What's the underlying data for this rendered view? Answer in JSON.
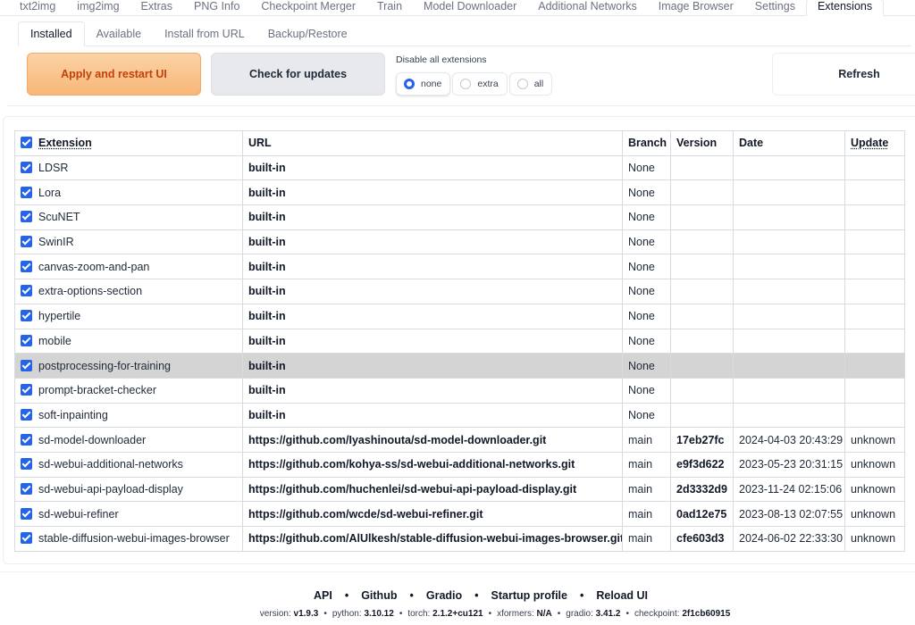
{
  "top_tabs": [
    "txt2img",
    "img2img",
    "Extras",
    "PNG Info",
    "Checkpoint Merger",
    "Train",
    "Model Downloader",
    "Additional Networks",
    "Image Browser",
    "Settings",
    "Extensions"
  ],
  "sub_tabs": [
    "Installed",
    "Available",
    "Install from URL",
    "Backup/Restore"
  ],
  "actions": {
    "apply_label": "Apply and restart UI",
    "check_label": "Check for updates",
    "refresh_label": "Refresh"
  },
  "disable": {
    "label": "Disable all extensions",
    "options": [
      "none",
      "extra",
      "all"
    ],
    "selected": "none"
  },
  "colors": {
    "accent": "#2563eb",
    "apply_bg": "#f8b677",
    "apply_text": "#c2410c",
    "highlight_row": "#d4d4d4"
  },
  "table": {
    "headers": [
      "Extension",
      "URL",
      "Branch",
      "Version",
      "Date",
      "Update"
    ],
    "rows": [
      {
        "name": "LDSR",
        "url": "built-in",
        "branch": "None",
        "version": "",
        "date": "",
        "update": ""
      },
      {
        "name": "Lora",
        "url": "built-in",
        "branch": "None",
        "version": "",
        "date": "",
        "update": ""
      },
      {
        "name": "ScuNET",
        "url": "built-in",
        "branch": "None",
        "version": "",
        "date": "",
        "update": ""
      },
      {
        "name": "SwinIR",
        "url": "built-in",
        "branch": "None",
        "version": "",
        "date": "",
        "update": ""
      },
      {
        "name": "canvas-zoom-and-pan",
        "url": "built-in",
        "branch": "None",
        "version": "",
        "date": "",
        "update": ""
      },
      {
        "name": "extra-options-section",
        "url": "built-in",
        "branch": "None",
        "version": "",
        "date": "",
        "update": ""
      },
      {
        "name": "hypertile",
        "url": "built-in",
        "branch": "None",
        "version": "",
        "date": "",
        "update": ""
      },
      {
        "name": "mobile",
        "url": "built-in",
        "branch": "None",
        "version": "",
        "date": "",
        "update": ""
      },
      {
        "name": "postprocessing-for-training",
        "url": "built-in",
        "branch": "None",
        "version": "",
        "date": "",
        "update": "",
        "highlighted": true
      },
      {
        "name": "prompt-bracket-checker",
        "url": "built-in",
        "branch": "None",
        "version": "",
        "date": "",
        "update": ""
      },
      {
        "name": "soft-inpainting",
        "url": "built-in",
        "branch": "None",
        "version": "",
        "date": "",
        "update": ""
      },
      {
        "name": "sd-model-downloader",
        "url": "https://github.com/Iyashinouta/sd-model-downloader.git",
        "branch": "main",
        "version": "17eb27fc",
        "date": "2024-04-03 20:43:29",
        "update": "unknown"
      },
      {
        "name": "sd-webui-additional-networks",
        "url": "https://github.com/kohya-ss/sd-webui-additional-networks.git",
        "branch": "main",
        "version": "e9f3d622",
        "date": "2023-05-23 20:31:15",
        "update": "unknown"
      },
      {
        "name": "sd-webui-api-payload-display",
        "url": "https://github.com/huchenlei/sd-webui-api-payload-display.git",
        "branch": "main",
        "version": "2d3332d9",
        "date": "2023-11-24 02:15:06",
        "update": "unknown"
      },
      {
        "name": "sd-webui-refiner",
        "url": "https://github.com/wcde/sd-webui-refiner.git",
        "branch": "main",
        "version": "0ad12e75",
        "date": "2023-08-13 02:07:55",
        "update": "unknown"
      },
      {
        "name": "stable-diffusion-webui-images-browser",
        "url": "https://github.com/AlUlkesh/stable-diffusion-webui-images-browser.git",
        "branch": "main",
        "version": "cfe603d3",
        "date": "2024-06-02 22:33:30",
        "update": "unknown"
      }
    ]
  },
  "footer": {
    "links": [
      "API",
      "Github",
      "Gradio",
      "Startup profile",
      "Reload UI"
    ],
    "separator": "•",
    "versions": [
      {
        "label": "version: ",
        "value": "v1.9.3"
      },
      {
        "label": "python: ",
        "value": "3.10.12"
      },
      {
        "label": "torch: ",
        "value": "2.1.2+cu121"
      },
      {
        "label": "xformers: ",
        "value": "N/A"
      },
      {
        "label": "gradio: ",
        "value": "3.41.2"
      },
      {
        "label": "checkpoint: ",
        "value": "2f1cb60915"
      }
    ]
  }
}
